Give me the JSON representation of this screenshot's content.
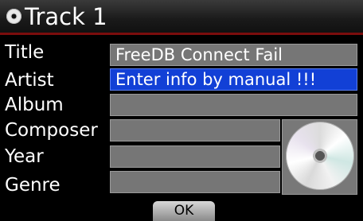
{
  "header": {
    "title": "Track 1",
    "icon": "disc-icon"
  },
  "labels": {
    "title": "Title",
    "artist": "Artist",
    "album": "Album",
    "composer": "Composer",
    "year": "Year",
    "genre": "Genre"
  },
  "fields": {
    "title": "FreeDB Connect Fail",
    "artist": "Enter info by manual !!!",
    "album": "",
    "composer": "",
    "year": "",
    "genre": ""
  },
  "ok_label": "OK",
  "colors": {
    "accent": "#7a0d0d",
    "selected": "#1240d6",
    "field": "#767676"
  }
}
